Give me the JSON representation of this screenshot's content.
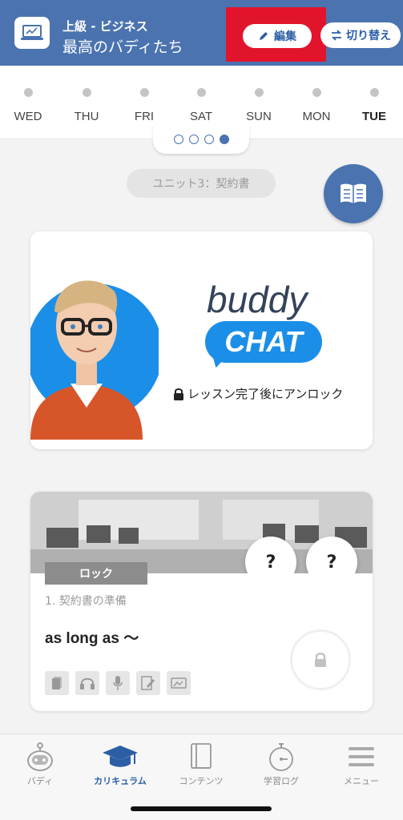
{
  "header": {
    "level": "上級 - ビジネス",
    "course": "最高のバディたち",
    "edit_label": "編集",
    "switch_label": "切り替え"
  },
  "week": {
    "days": [
      "WED",
      "THU",
      "FRI",
      "SAT",
      "SUN",
      "MON",
      "TUE"
    ],
    "today": "TUE",
    "pager_pages": 4,
    "pager_active": 4
  },
  "unit": {
    "label": "ユニット3：契約書"
  },
  "buddy_card": {
    "logo_text": "buddy",
    "chat_text": "CHAT",
    "unlock_note": "レッスン完了後にアンロック"
  },
  "lesson": {
    "badge": "ロック",
    "number": "1. 契約書の準備",
    "title": "as long as 〜",
    "question_mark_1": "?",
    "question_mark_2": "?",
    "skills": [
      "cards-icon",
      "headphones-icon",
      "microphone-icon",
      "writing-icon",
      "image-card-icon"
    ]
  },
  "nav": {
    "items": [
      {
        "label": "バディ",
        "icon": "robot-icon"
      },
      {
        "label": "カリキュラム",
        "icon": "graduation-cap-icon"
      },
      {
        "label": "コンテンツ",
        "icon": "book-icon"
      },
      {
        "label": "学習ログ",
        "icon": "stopwatch-icon"
      },
      {
        "label": "メニュー",
        "icon": "menu-icon"
      }
    ],
    "active": "カリキュラム"
  },
  "colors": {
    "header": "#4a73b0",
    "accent_red": "#e2142c",
    "chat_blue": "#1b8fe8"
  }
}
